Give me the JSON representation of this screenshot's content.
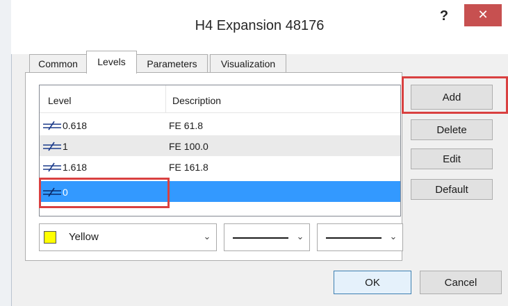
{
  "window": {
    "title": "H4 Expansion 48176",
    "help_label": "?",
    "close_label": "✕"
  },
  "tabs": [
    {
      "label": "Common",
      "active": false
    },
    {
      "label": "Levels",
      "active": true
    },
    {
      "label": "Parameters",
      "active": false
    },
    {
      "label": "Visualization",
      "active": false
    }
  ],
  "levels_list": {
    "headers": {
      "level": "Level",
      "description": "Description"
    },
    "rows": [
      {
        "level": "0.618",
        "description": "FE 61.8",
        "selected": false
      },
      {
        "level": "1",
        "description": "FE 100.0",
        "selected": false
      },
      {
        "level": "1.618",
        "description": "FE 161.8",
        "selected": false
      },
      {
        "level": "0",
        "description": "",
        "selected": true
      }
    ]
  },
  "buttons": {
    "add": "Add",
    "delete": "Delete",
    "edit": "Edit",
    "default": "Default",
    "ok": "OK",
    "cancel": "Cancel"
  },
  "style_controls": {
    "color": {
      "label": "Yellow",
      "hex": "#ffff00"
    },
    "line_style": "solid",
    "line_width": "thin"
  },
  "colors": {
    "selection": "#3399ff",
    "highlight_box": "#d94040",
    "close_button": "#c75050"
  }
}
